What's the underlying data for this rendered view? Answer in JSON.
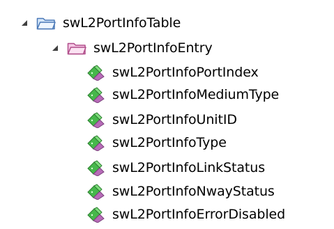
{
  "tree": {
    "root": {
      "label": "swL2PortInfoTable",
      "icon": "open-folder-icon",
      "expanded": true
    },
    "entry": {
      "label": "swL2PortInfoEntry",
      "icon": "open-folder-icon",
      "expanded": true
    },
    "leaves": [
      {
        "label": "swL2PortInfoPortIndex",
        "icon": "column-object-icon"
      },
      {
        "label": "swL2PortInfoMediumType",
        "icon": "column-object-icon"
      },
      {
        "label": "swL2PortInfoUnitID",
        "icon": "column-object-icon"
      },
      {
        "label": "swL2PortInfoType",
        "icon": "column-object-icon"
      },
      {
        "label": "swL2PortInfoLinkStatus",
        "icon": "column-object-icon"
      },
      {
        "label": "swL2PortInfoNwayStatus",
        "icon": "column-object-icon"
      },
      {
        "label": "swL2PortInfoErrorDisabled",
        "icon": "column-object-icon"
      }
    ]
  },
  "colors": {
    "expander": "#3f3f3f",
    "table_folder_outline": "#4a78b7",
    "table_folder_fill": "#d6e8fb",
    "entry_folder_outline": "#b04d8a",
    "entry_folder_fill": "#f6c9e6",
    "leaf_icon_green": "#46b84b",
    "leaf_icon_purple": "#b76bb8"
  }
}
